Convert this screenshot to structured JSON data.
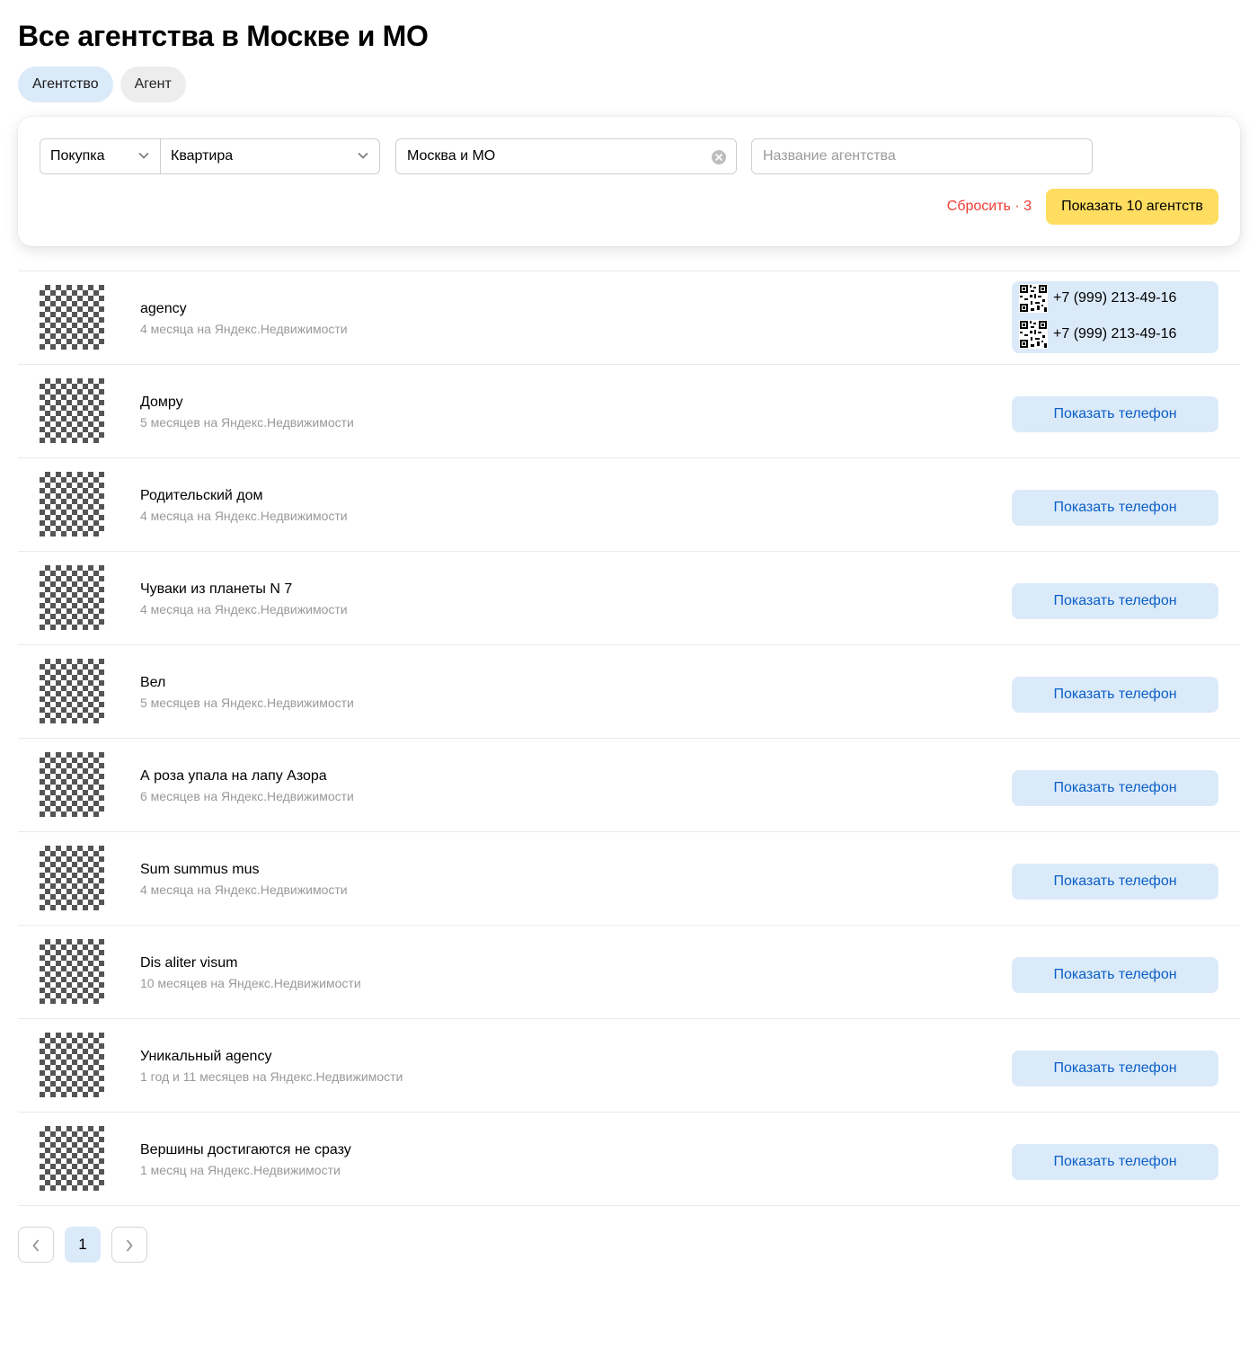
{
  "page": {
    "title": "Все агентства в Москве и МО"
  },
  "tabs": [
    {
      "label": "Агентство",
      "active": true
    },
    {
      "label": "Агент",
      "active": false
    }
  ],
  "filters": {
    "deal_type": "Покупка",
    "property_type": "Квартира",
    "geo": "Москва и МО",
    "name_placeholder": "Название агентства",
    "reset_label": "Сбросить · 3",
    "show_label": "Показать 10 агентств"
  },
  "show_phone_label": "Показать телефон",
  "agencies": [
    {
      "name": "agency",
      "meta": "4 месяца на Яндекс.Недвижимости",
      "phones": [
        "+7 (999) 213-49-16",
        "+7 (999) 213-49-16"
      ]
    },
    {
      "name": "Домру",
      "meta": "5 месяцев на Яндекс.Недвижимости"
    },
    {
      "name": "Родительский дом",
      "meta": "4 месяца на Яндекс.Недвижимости"
    },
    {
      "name": "Чуваки из планеты N 7",
      "meta": "4 месяца на Яндекс.Недвижимости"
    },
    {
      "name": "Вел",
      "meta": "5 месяцев на Яндекс.Недвижимости"
    },
    {
      "name": "А роза упала на лапу Азора",
      "meta": "6 месяцев на Яндекс.Недвижимости"
    },
    {
      "name": "Sum summus mus",
      "meta": "4 месяца на Яндекс.Недвижимости"
    },
    {
      "name": "Dis aliter visum",
      "meta": "10 месяцев на Яндекс.Недвижимости"
    },
    {
      "name": "Уникальный agency",
      "meta": "1 год и 11 месяцев на Яндекс.Недвижимости"
    },
    {
      "name": "Вершины достигаются не сразу",
      "meta": "1 месяц на Яндекс.Недвижимости"
    }
  ],
  "pagination": {
    "current": "1"
  },
  "colors": {
    "accent_blue": "#0b5fc6",
    "pill_blue": "#dbeaf9",
    "cta_yellow": "#ffdd60",
    "reset_red": "#f33b32"
  }
}
